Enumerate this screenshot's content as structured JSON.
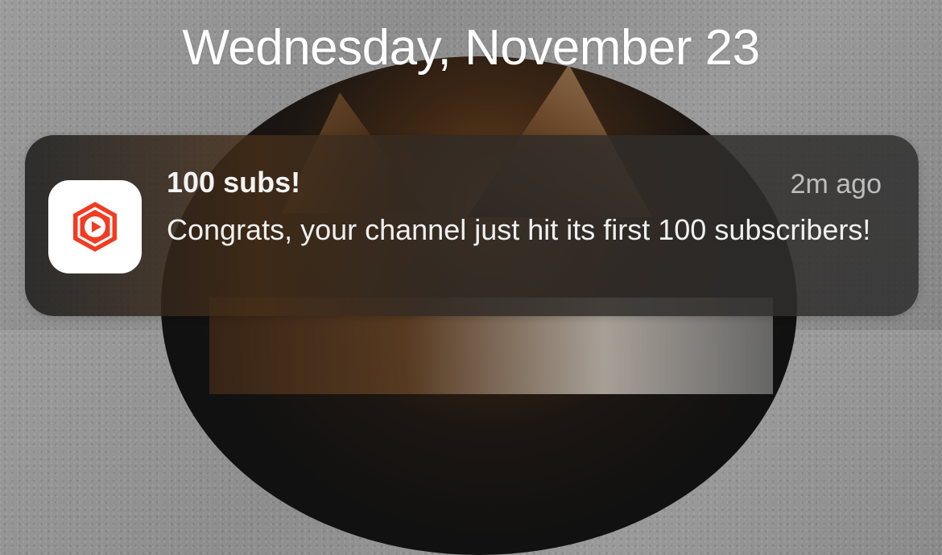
{
  "lockscreen": {
    "date_label": "Wednesday, November 23"
  },
  "notification": {
    "app_icon": "youtube-studio-icon",
    "title": "100 subs!",
    "time": "2m ago",
    "message": "Congrats, your channel just hit its first 100 subscribers!"
  },
  "colors": {
    "icon_red": "#f03c22",
    "icon_white": "#ffffff",
    "notification_text": "#f0f0f0"
  }
}
